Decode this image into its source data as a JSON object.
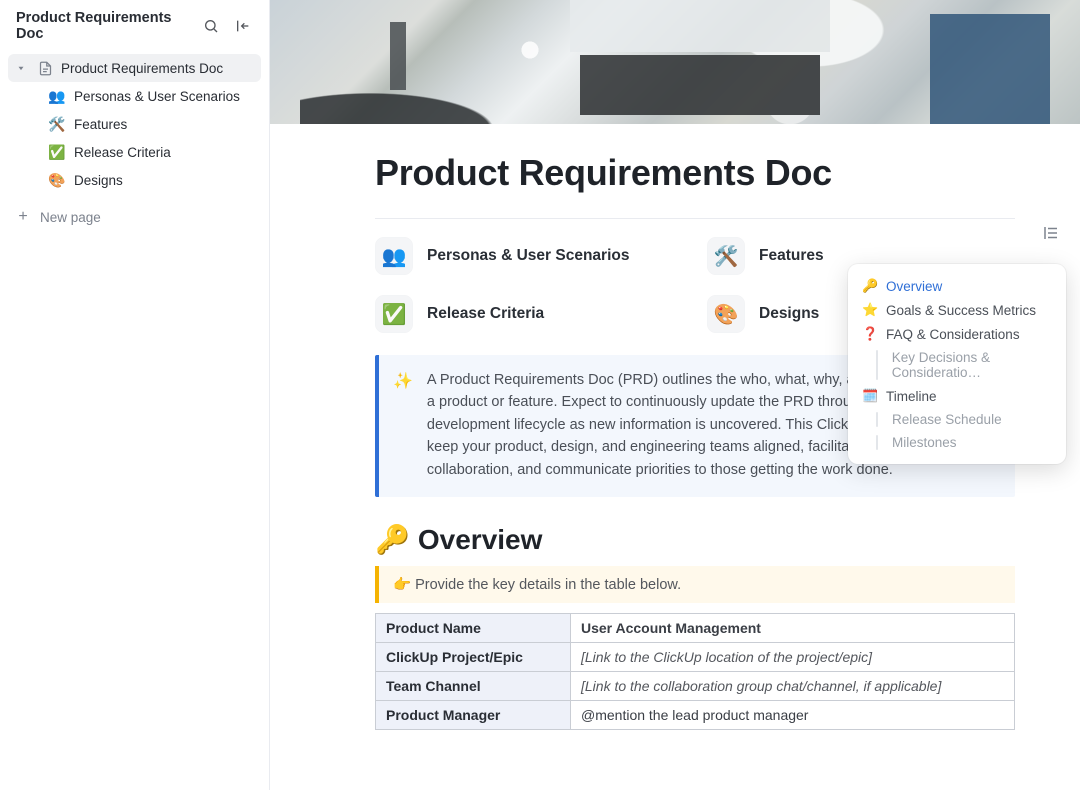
{
  "sidebar": {
    "title": "Product Requirements Doc",
    "root_label": "Product Requirements Doc",
    "children": [
      {
        "icon": "👥",
        "label": "Personas & User Scenarios"
      },
      {
        "icon": "🛠️",
        "label": "Features"
      },
      {
        "icon": "✅",
        "label": "Release Criteria"
      },
      {
        "icon": "🎨",
        "label": "Designs"
      }
    ],
    "new_page": "New page"
  },
  "document": {
    "title": "Product Requirements Doc",
    "page_links": [
      {
        "icon": "👥",
        "label": "Personas & User Scenarios"
      },
      {
        "icon": "🛠️",
        "label": "Features"
      },
      {
        "icon": "✅",
        "label": "Release Criteria"
      },
      {
        "icon": "🎨",
        "label": "Designs"
      }
    ],
    "callout": {
      "emoji": "✨",
      "text": "A Product Requirements Doc (PRD) outlines the who, what, why, and how of developing a product or feature. Expect to continuously update the PRD throughout the development lifecycle as new information is uncovered. This ClickUp template will help keep your product, design, and engineering teams aligned, facilitate long-term collaboration, and communicate priorities to those getting the work done."
    },
    "overview": {
      "emoji": "🔑",
      "heading": "Overview",
      "note_emoji": "👉",
      "note": "Provide the key details in the table below.",
      "table": [
        {
          "key": "Product Name",
          "value": "User Account Management",
          "italic": false
        },
        {
          "key": "ClickUp Project/Epic",
          "value": "[Link to the ClickUp location of the project/epic]",
          "italic": true
        },
        {
          "key": "Team Channel",
          "value": "[Link to the collaboration group chat/channel, if applicable]",
          "italic": true
        },
        {
          "key": "Product Manager",
          "value": "@mention the lead product manager",
          "italic": false
        }
      ]
    }
  },
  "outline": [
    {
      "emoji": "🔑",
      "label": "Overview",
      "active": true
    },
    {
      "emoji": "⭐",
      "label": "Goals & Success Metrics"
    },
    {
      "emoji": "❓",
      "label": "FAQ & Considerations"
    },
    {
      "sub": true,
      "label": "Key Decisions & Consideratio…"
    },
    {
      "emoji": "🗓️",
      "label": "Timeline"
    },
    {
      "sub": true,
      "label": "Release Schedule"
    },
    {
      "sub": true,
      "label": "Milestones"
    }
  ]
}
